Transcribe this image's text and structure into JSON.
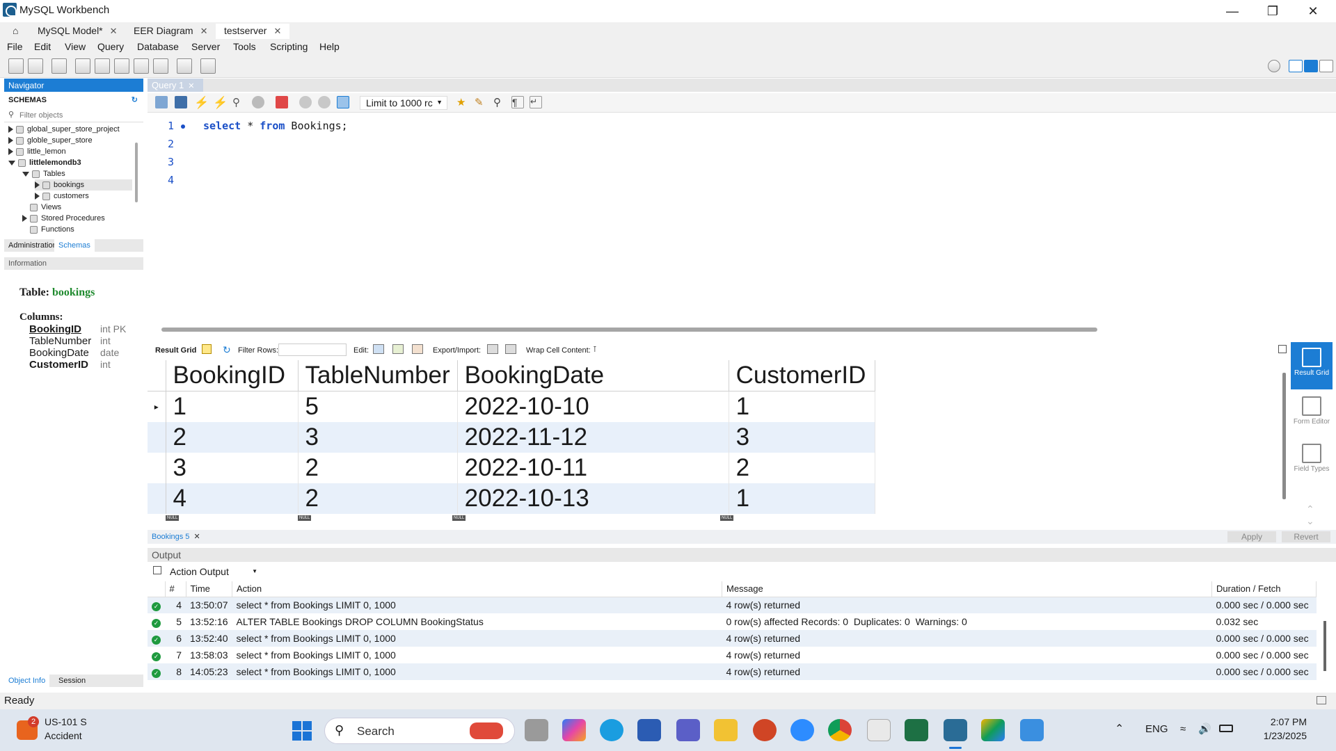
{
  "window": {
    "title": "MySQL Workbench"
  },
  "tabs": [
    {
      "label": "MySQL Model*"
    },
    {
      "label": "EER Diagram"
    },
    {
      "label": "testserver"
    }
  ],
  "menu": [
    "File",
    "Edit",
    "View",
    "Query",
    "Database",
    "Server",
    "Tools",
    "Scripting",
    "Help"
  ],
  "navigator": {
    "header": "Navigator",
    "schemas_label": "SCHEMAS",
    "filter_placeholder": "Filter objects",
    "tree": [
      {
        "label": "global_super_store_project",
        "bold": false
      },
      {
        "label": "globle_super_store",
        "bold": false
      },
      {
        "label": "little_lemon",
        "bold": false
      },
      {
        "label": "littlelemondb3",
        "bold": true
      },
      {
        "label": "Tables"
      },
      {
        "label": "bookings"
      },
      {
        "label": "customers"
      },
      {
        "label": "Views"
      },
      {
        "label": "Stored Procedures"
      },
      {
        "label": "Functions"
      }
    ],
    "tab_admin": "Administration",
    "tab_schemas": "Schemas",
    "info_header": "Information",
    "info": {
      "table_label": "Table:",
      "table_name": "bookings",
      "columns_label": "Columns:",
      "columns": [
        {
          "name": "BookingID",
          "type": "int PK"
        },
        {
          "name": "TableNumber",
          "type": "int"
        },
        {
          "name": "BookingDate",
          "type": "date"
        },
        {
          "name": "CustomerID",
          "type": "int"
        }
      ]
    },
    "bottom_tab_object": "Object Info",
    "bottom_tab_session": "Session"
  },
  "query": {
    "tab_label": "Query 1",
    "limit_label": "Limit to 1000 rc",
    "lines": [
      "1",
      "2",
      "3",
      "4"
    ],
    "code": {
      "kw1": "select",
      "mid": " * ",
      "kw2": "from",
      "rest": " Bookings;"
    }
  },
  "result_toolbar": {
    "result_grid": "Result Grid",
    "filter_rows": "Filter Rows:",
    "edit": "Edit:",
    "export_import": "Export/Import:",
    "wrap": "Wrap Cell Content:"
  },
  "grid": {
    "columns": [
      "BookingID",
      "TableNumber",
      "BookingDate",
      "CustomerID"
    ],
    "rows": [
      [
        "1",
        "5",
        "2022-10-10",
        "1"
      ],
      [
        "2",
        "3",
        "2022-11-12",
        "3"
      ],
      [
        "3",
        "2",
        "2022-10-11",
        "2"
      ],
      [
        "4",
        "2",
        "2022-10-13",
        "1"
      ]
    ],
    "null_label": "NULL"
  },
  "side_panel": [
    {
      "label": "Result Grid"
    },
    {
      "label": "Form Editor"
    },
    {
      "label": "Field Types"
    }
  ],
  "results_tab": {
    "label": "Bookings 5",
    "apply": "Apply",
    "revert": "Revert"
  },
  "output": {
    "header": "Output",
    "selector": "Action Output",
    "columns": [
      "#",
      "Time",
      "Action",
      "Message",
      "Duration / Fetch"
    ],
    "rows": [
      {
        "n": "4",
        "time": "13:50:07",
        "action": "select * from Bookings LIMIT 0, 1000",
        "message": "4 row(s) returned",
        "duration": "0.000 sec / 0.000 sec"
      },
      {
        "n": "5",
        "time": "13:52:16",
        "action": "ALTER TABLE Bookings DROP COLUMN BookingStatus",
        "message": "0 row(s) affected Records: 0  Duplicates: 0  Warnings: 0",
        "duration": "0.032 sec"
      },
      {
        "n": "6",
        "time": "13:52:40",
        "action": "select * from Bookings LIMIT 0, 1000",
        "message": "4 row(s) returned",
        "duration": "0.000 sec / 0.000 sec"
      },
      {
        "n": "7",
        "time": "13:58:03",
        "action": "select * from Bookings LIMIT 0, 1000",
        "message": "4 row(s) returned",
        "duration": "0.000 sec / 0.000 sec"
      },
      {
        "n": "8",
        "time": "14:05:23",
        "action": "select * from Bookings LIMIT 0, 1000",
        "message": "4 row(s) returned",
        "duration": "0.000 sec / 0.000 sec"
      }
    ]
  },
  "status": "Ready",
  "taskbar": {
    "traffic_badge": "2",
    "traffic_title": "US-101 S",
    "traffic_sub": "Accident",
    "search": "Search",
    "lang": "ENG",
    "time": "2:07 PM",
    "date": "1/23/2025"
  },
  "colors": {
    "accent": "#1c7dd4",
    "ok": "#1f9a3f",
    "keyword": "#1a4fc7",
    "table_name": "#1f8a2e"
  }
}
